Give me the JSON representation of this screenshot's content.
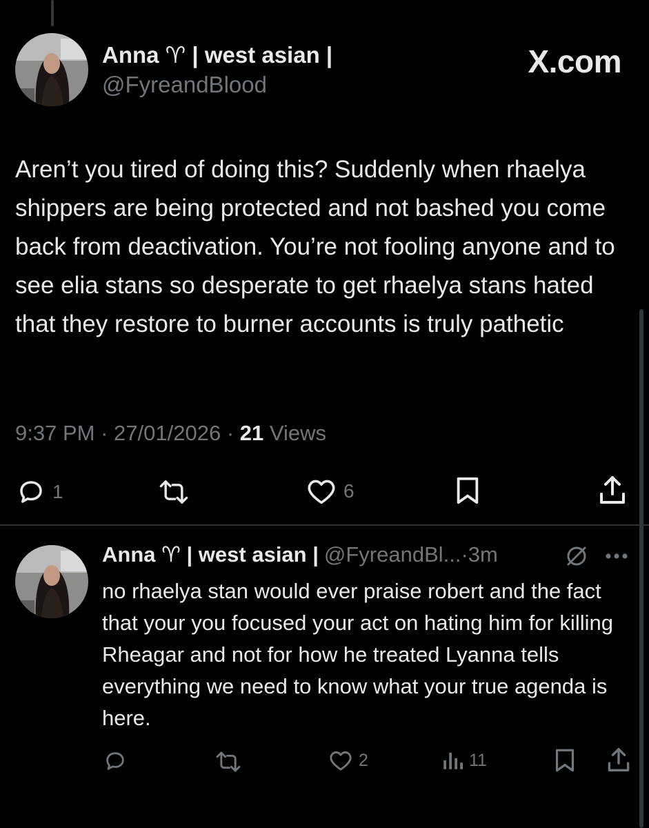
{
  "brand": {
    "label": "X.com"
  },
  "main_post": {
    "author_name": "Anna ♈︎ | west asian |",
    "handle": "@FyreandBlood",
    "text": "Aren’t you tired of doing this? Suddenly when rhaelya shippers are being protected and not bashed you come back from deactivation. You’re not fooling anyone and to see elia stans so desperate to get rhaelya stans hated that they restore to burner accounts is truly pathetic",
    "time": "9:37 PM",
    "date": "27/01/2026",
    "separator": "·",
    "views_count": "21",
    "views_label": "Views",
    "actions": {
      "reply_count": "1",
      "like_count": "6"
    }
  },
  "reply": {
    "author_name": "Anna ♈︎ | west asian |",
    "handle": "@FyreandBl...",
    "time": "·3m",
    "text": "no rhaelya stan would ever praise robert and the fact that your you focused your act on hating him for killing Rheagar and not for how he treated Lyanna tells everything we need to know what your true agenda is here.",
    "actions": {
      "like_count": "2",
      "views_count": "11"
    }
  },
  "icons": {
    "reply": "reply-icon",
    "repost": "repost-icon",
    "like": "heart-icon",
    "bookmark": "bookmark-icon",
    "share": "share-icon",
    "views": "views-chart-icon",
    "grok": "grok-icon",
    "more": "more-icon"
  },
  "colors": {
    "background": "#000000",
    "text_primary": "#e7e9ea",
    "text_secondary": "#71767b",
    "divider": "#2f3336"
  }
}
